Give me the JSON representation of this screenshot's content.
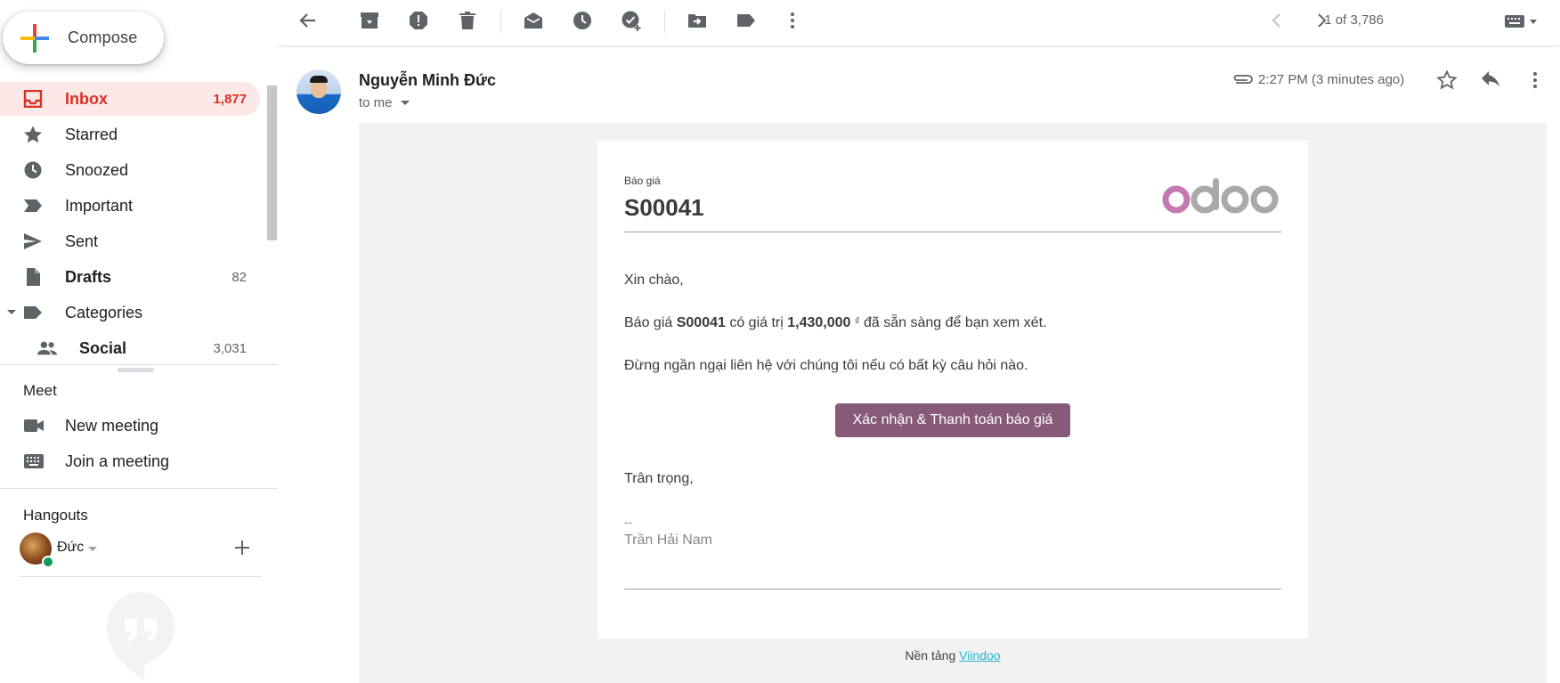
{
  "sidebar": {
    "compose_label": "Compose",
    "items": [
      {
        "label": "Inbox",
        "count": "1,877"
      },
      {
        "label": "Starred",
        "count": ""
      },
      {
        "label": "Snoozed",
        "count": ""
      },
      {
        "label": "Important",
        "count": ""
      },
      {
        "label": "Sent",
        "count": ""
      },
      {
        "label": "Drafts",
        "count": "82"
      },
      {
        "label": "Categories",
        "count": ""
      },
      {
        "label": "Social",
        "count": "3,031"
      }
    ]
  },
  "meet": {
    "title": "Meet",
    "items": [
      {
        "label": "New meeting"
      },
      {
        "label": "Join a meeting"
      }
    ]
  },
  "hangouts": {
    "title": "Hangouts",
    "user_name": "Đức"
  },
  "toolbar": {
    "pager": "1 of 3,786"
  },
  "message": {
    "sender": "Nguyễn Minh Đức",
    "recipient": "to me",
    "time": "2:27 PM (3 minutes ago)"
  },
  "email": {
    "doc_label": "Báo giá",
    "doc_number": "S00041",
    "logo_text": "odoo",
    "greeting": "Xin chào,",
    "line1_pre": "Báo giá ",
    "line1_ref": "S00041",
    "line1_mid": " có giá trị ",
    "line1_amount": "1,430,000",
    "line1_currency": "₫",
    "line1_post": " đã sẵn sàng để bạn xem xét.",
    "line2": "Đừng ngần ngại liên hệ với chúng tôi nếu có bất kỳ câu hỏi nào.",
    "cta_label": "Xác nhận & Thanh toán báo giá",
    "closing": "Trân trọng,",
    "sig_dash": "--",
    "sig_name": "Trần Hải Nam",
    "footer_pre": "Nền tảng ",
    "footer_link": "Viindoo"
  },
  "colors": {
    "inbox_active": "#d93025",
    "inbox_active_bg": "#fce8e6",
    "cta": "#875a7b",
    "odoo_o": "#c479b0",
    "odoo_doo": "#a9a9a9",
    "link": "#21b6d1"
  }
}
